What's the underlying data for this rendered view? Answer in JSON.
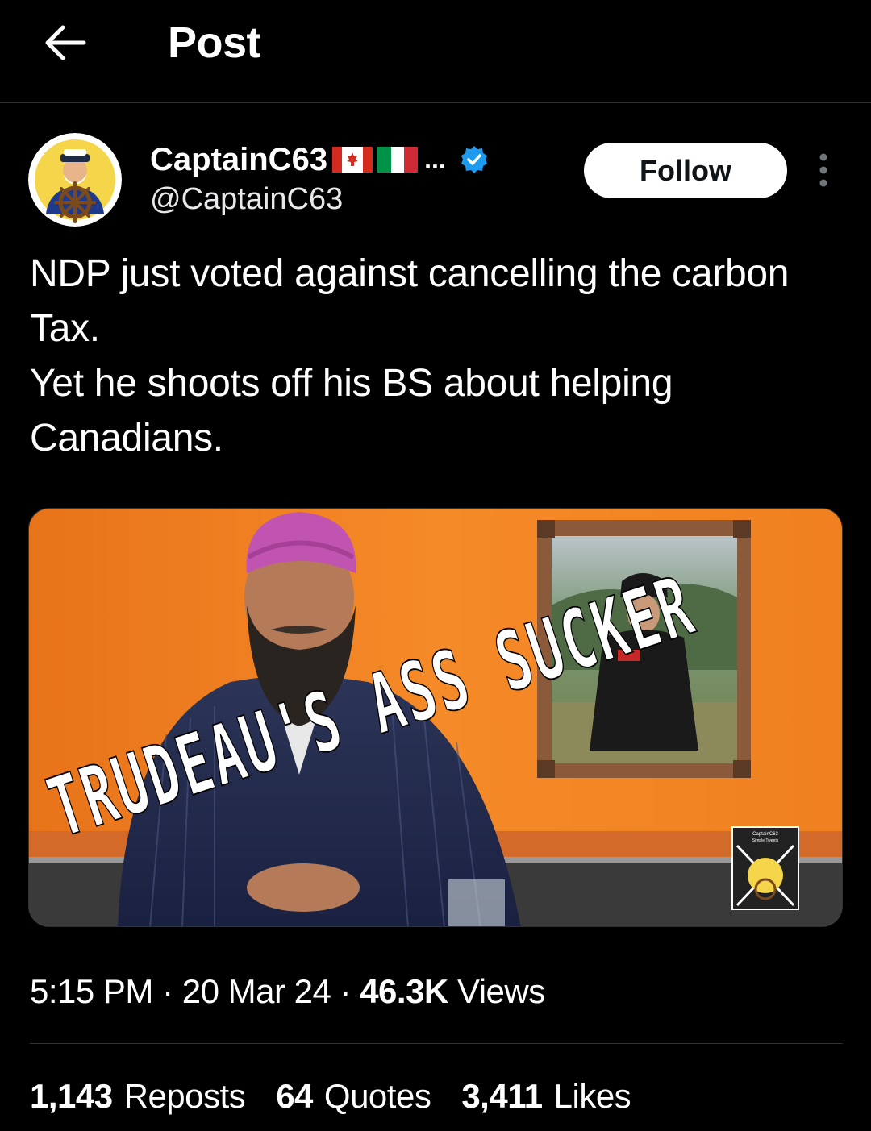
{
  "header": {
    "title": "Post",
    "back_icon": "arrow-left-icon"
  },
  "author": {
    "display_name": "CaptainC63",
    "flags": [
      "canada-flag-icon",
      "italy-flag-icon"
    ],
    "truncation": "...",
    "handle": "@CaptainC63",
    "verified_icon": "verified-badge-icon",
    "verified_color": "#1d9bf0"
  },
  "follow_button": {
    "label": "Follow"
  },
  "more_icon": "more-vertical-icon",
  "tweet": {
    "lines": [
      "NDP just voted against cancelling the carbon Tax.",
      "Yet he shoots off his BS about helping Canadians."
    ]
  },
  "media": {
    "overlay_text": "TRUDEAU'S ASS SUCKER",
    "watermark_top": "CaptainC63",
    "watermark_sub": "Simple Tweets"
  },
  "meta": {
    "time": "5:15 PM",
    "date": "20 Mar 24",
    "views_count": "46.3K",
    "views_label": "Views",
    "separator": " · "
  },
  "stats": {
    "reposts_count": "1,143",
    "reposts_label": "Reposts",
    "quotes_count": "64",
    "quotes_label": "Quotes",
    "likes_count": "3,411",
    "likes_label": "Likes"
  },
  "colors": {
    "background": "#000000",
    "text": "#ffffff",
    "divider": "#2f3336",
    "accent": "#1d9bf0",
    "image_orange": "#f07a1a"
  }
}
